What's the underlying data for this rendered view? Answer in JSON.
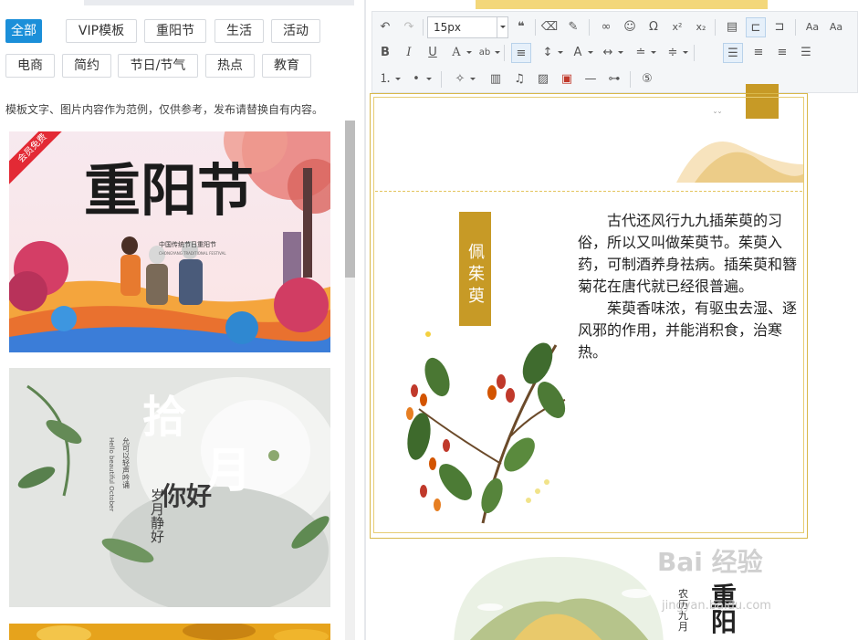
{
  "categories": {
    "row1": [
      {
        "label": "全部",
        "active": true
      },
      {
        "label": "VIP模板"
      },
      {
        "label": "重阳节"
      },
      {
        "label": "生活"
      },
      {
        "label": "活动"
      }
    ],
    "row2": [
      {
        "label": "电商"
      },
      {
        "label": "简约"
      },
      {
        "label": "节日/节气"
      },
      {
        "label": "热点"
      },
      {
        "label": "教育"
      }
    ]
  },
  "notice": "模板文字、图片内容作为范例，仅供参考，发布请替换自有内容。",
  "templates": [
    {
      "ribbon": "会员免费",
      "title": "重阳节",
      "subtitle": "中国传统节日重阳节",
      "subtitle_en": "CHONGYANG TRADITIONAL FESTIVAL"
    },
    {
      "title_a": "拾",
      "title_b": "月",
      "title_c": "你好",
      "tagline": "岁月静好",
      "poem": "允可以轻声吟诵 时间静水流深 不会为谁停留",
      "en": "Hello beautiful October"
    },
    {}
  ],
  "toolbar": {
    "font_size": "15px",
    "colors": {
      "accent_on": "#e6f0fa"
    }
  },
  "doc": {
    "side_title": "佩茱萸",
    "top_tag": "",
    "paragraph1": "古代还风行九九插茱萸的习俗，所以又叫做茱萸节。茱萸入药，可制酒养身祛病。插茱萸和簪菊花在唐代就已经很普遍。",
    "paragraph2": "茱萸香味浓，有驱虫去湿、逐风邪的作用，并能消积食，治寒热。",
    "bottom_title": "重\n阳",
    "bottom_small": "农历九月"
  },
  "watermark": {
    "main": "Bai 经验",
    "sub": "jingyan.baidu.com"
  }
}
